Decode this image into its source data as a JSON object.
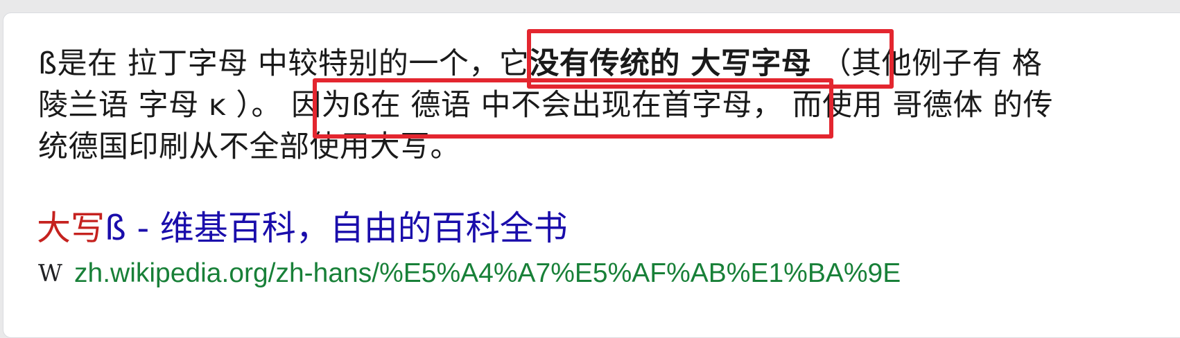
{
  "snippet": {
    "line1_a": "ß是在 拉丁字母 中较特别的一个，它",
    "line1_bold": "没有传统的 大写字母",
    "line1_b": " （其他例子有 格",
    "line2_a": "陵兰语 字母 ĸ ）。 因为ß在 德语 中不会出现在首字母，",
    "line2_b": " 而使用 哥德体 的传",
    "line3": "统德国印刷从不全部使用大写。"
  },
  "result": {
    "title_highlight": "大写",
    "title_rest": "ß - 维基百科，自由的百科全书",
    "favicon_glyph": "W",
    "favicon_name": "wikipedia-icon",
    "url": "zh.wikipedia.org/zh-hans/%E5%A4%A7%E5%AF%AB%E1%BA%9E"
  },
  "colors": {
    "highlight_box": "#e3262f",
    "title_highlight": "#c5221f",
    "title_link": "#1a0dab",
    "url": "#188038"
  }
}
